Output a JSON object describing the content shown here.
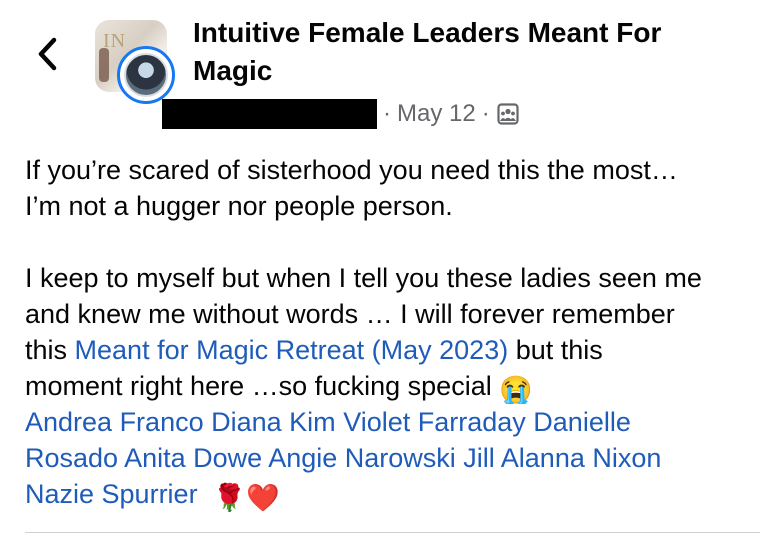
{
  "post": {
    "group_name": "Intuitive Female Leaders Meant For Magic",
    "date": "May 12",
    "meta_dot_1": "·",
    "meta_dot_2": "·",
    "body_lines": {
      "l1": "If you’re scared of sisterhood you need this the most…",
      "l2": "I’m not a hugger nor people person.",
      "l3": "I keep to myself but when I tell you these ladies seen me",
      "l4": "and knew me without words … I will forever remember",
      "l5_prefix": "this ",
      "l5_link": "Meant for Magic Retreat (May 2023)",
      "l5_suffix": " but this",
      "l6": "moment right here …so fucking special"
    },
    "tags": {
      "t1": "Andrea Franco",
      "t2": "Diana Kim",
      "t3": "Violet Farraday",
      "t4": "Danielle",
      "t5": "Rosado",
      "t6": "Anita Dowe",
      "t7": "Angie Narowski",
      "t8": "Jill Alanna Nixon",
      "t9": "Nazie Spurrier"
    },
    "emojis": {
      "crying": "😭",
      "rose": "🌹",
      "heart": "❤️"
    }
  },
  "icons": {
    "back": "chevron-left-icon",
    "audience": "group-audience-icon"
  },
  "colors": {
    "link": "#1f5cba",
    "meta": "#65676b",
    "avatar_ring": "#1877f2"
  }
}
